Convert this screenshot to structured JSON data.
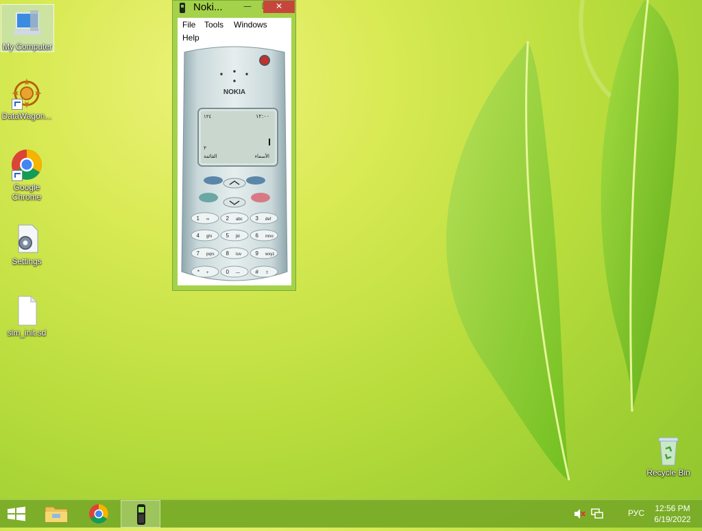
{
  "desktop": {
    "icons": [
      {
        "label": "My Computer",
        "icon": "computer-icon"
      },
      {
        "label": "DataWagon...",
        "icon": "datawagon-icon"
      },
      {
        "label": "Google Chrome",
        "icon": "chrome-icon"
      },
      {
        "label": "Settings",
        "icon": "settings-icon"
      },
      {
        "label": "sim_init.sd",
        "icon": "file-icon"
      },
      {
        "label": "Recycle Bin",
        "icon": "recycle-bin-icon"
      }
    ]
  },
  "window": {
    "title": "Noki...",
    "icon": "phone-icon",
    "controls": {
      "minimize": "—",
      "maximize": "☐",
      "close": "✕"
    },
    "menu": [
      "File",
      "Tools",
      "Windows",
      "Help"
    ]
  },
  "phone": {
    "brand": "NOKIA",
    "screen": {
      "signal": "١٢٤",
      "time": "١٢:٠٠",
      "number": "٣",
      "left_softkey": "القائمة",
      "right_softkey": "الأسماء"
    },
    "keys": [
      {
        "num": "1",
        "sub": "∞"
      },
      {
        "num": "2",
        "sub": "abc"
      },
      {
        "num": "3",
        "sub": "def"
      },
      {
        "num": "4",
        "sub": "ghi"
      },
      {
        "num": "5",
        "sub": "jkl"
      },
      {
        "num": "6",
        "sub": "mno"
      },
      {
        "num": "7",
        "sub": "pqrs"
      },
      {
        "num": "8",
        "sub": "tuv"
      },
      {
        "num": "9",
        "sub": "wxyz"
      },
      {
        "num": "*",
        "sub": "+"
      },
      {
        "num": "0",
        "sub": "—"
      },
      {
        "num": "#",
        "sub": "⇧"
      }
    ]
  },
  "taskbar": {
    "items": [
      "start-icon",
      "file-explorer-icon",
      "chrome-icon",
      "nokia-emulator-icon"
    ],
    "tray": {
      "language": "РУС",
      "time": "12:56 PM",
      "date": "6/19/2022",
      "icons": [
        "volume-muted-icon",
        "network-icon"
      ]
    }
  },
  "colors": {
    "accent": "#a4d24a",
    "close": "#c7463c",
    "taskbar": "#78aa28"
  }
}
